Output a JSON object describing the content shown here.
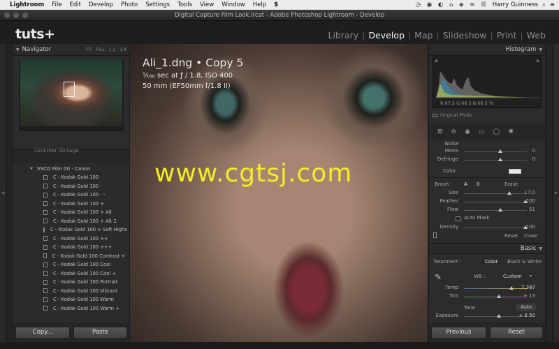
{
  "menubar": {
    "app": "Lightroom",
    "items": [
      "File",
      "Edit",
      "Develop",
      "Photo",
      "Settings",
      "Tools",
      "View",
      "Window",
      "Help"
    ],
    "user": "Harry Guinness"
  },
  "window": {
    "title": "Digital Capture Film Look.lrcat - Adobe Photoshop Lightroom - Develop"
  },
  "header": {
    "logo": "tuts+",
    "modules": [
      "Library",
      "Develop",
      "Map",
      "Slideshow",
      "Print",
      "Web"
    ],
    "active_module": "Develop"
  },
  "navigator": {
    "title": "Navigator",
    "options": [
      "FIT",
      "FILL",
      "1:1",
      "1:4"
    ]
  },
  "presets": {
    "collapsed_folder": "Lookmer Vintage",
    "folder": "VSCO Film 00 - Canon",
    "items": [
      "C - Kodak Gold 100",
      "C - Kodak Gold 100 -",
      "C - Kodak Gold 100 - -",
      "C - Kodak Gold 100 +",
      "C - Kodak Gold 100 + Alt",
      "C - Kodak Gold 100 + Alt 2",
      "C - Kodak Gold 100 + Soft Highs",
      "C - Kodak Gold 100 ++",
      "C - Kodak Gold 100 +++",
      "C - Kodak Gold 100 Contrast +",
      "C - Kodak Gold 100 Cool",
      "C - Kodak Gold 100 Cool +",
      "C - Kodak Gold 100 Portrait",
      "C - Kodak Gold 100 Vibrant",
      "C - Kodak Gold 100 Warm",
      "C - Kodak Gold 100 Warm +"
    ]
  },
  "left_buttons": {
    "copy": "Copy...",
    "paste": "Paste"
  },
  "photo": {
    "name": "Ali_1.dng  •  Copy 5",
    "line2": "¹⁄₁₈₀ sec at ƒ / 1.8, ISO 400",
    "line3": "50 mm (EF50mm f/1.8 II)",
    "watermark": "www.cgtsj.com"
  },
  "histogram": {
    "title": "Histogram",
    "readout": "R  67.5  G  66.5  B  66.5 %",
    "original_photo": "Original Photo"
  },
  "detail": {
    "sliders": [
      {
        "label": "Moire",
        "value": "0",
        "pos": 0.58
      },
      {
        "label": "Defringe",
        "value": "0",
        "pos": 0.58
      }
    ],
    "color_label": "Color"
  },
  "brush": {
    "label": "Brush :",
    "a": "A",
    "b": "B",
    "erase": "Erase",
    "sliders": [
      {
        "label": "Size",
        "value": "17.0",
        "pos": 0.72
      },
      {
        "label": "Feather",
        "value": "100",
        "pos": 0.98
      },
      {
        "label": "Flow",
        "value": "51",
        "pos": 0.58
      }
    ],
    "auto_mask": "Auto Mask",
    "density": {
      "label": "Density",
      "value": "100",
      "pos": 0.98
    },
    "reset": "Reset",
    "close": "Close"
  },
  "basic": {
    "title": "Basic",
    "treatment": "Treatment :",
    "color": "Color",
    "bw": "Black & White",
    "wb": "WB :",
    "wb_value": "Custom",
    "temp": {
      "label": "Temp",
      "value": "7,387",
      "pos": 0.76
    },
    "tint": {
      "label": "Tint",
      "value": "+ 13",
      "pos": 0.56
    },
    "tone": "Tone",
    "auto": "Auto",
    "exposure": {
      "label": "Exposure",
      "value": "+ 0.50",
      "pos": 0.56
    }
  },
  "right_buttons": {
    "previous": "Previous",
    "reset": "Reset"
  }
}
